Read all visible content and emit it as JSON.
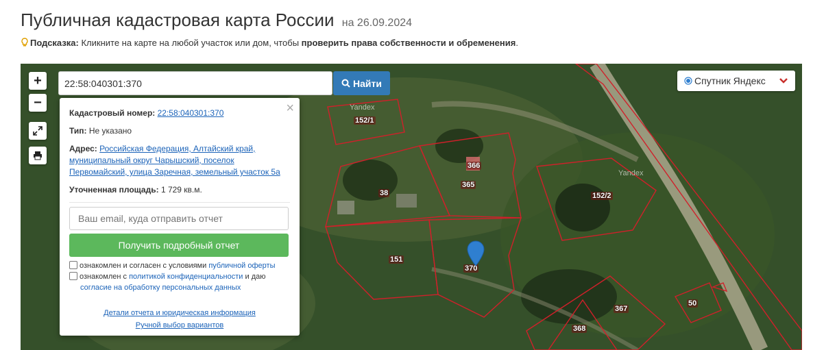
{
  "header": {
    "title": "Публичная кадастровая карта России",
    "date": "на 26.09.2024"
  },
  "hint": {
    "bold_label": "Подсказка:",
    "text": " Кликните на карте на любой участок или дом, чтобы ",
    "bold_action": "проверить права собственности и обременения",
    "end": "."
  },
  "map": {
    "zoom_in": "+",
    "zoom_out": "−",
    "search_value": "22:58:040301:370",
    "find_label": "Найти",
    "layer": "Спутник Яндекс",
    "parcel_labels": [
      "152/1",
      "366",
      "365",
      "38",
      "152/2",
      "151",
      "370",
      "367",
      "50",
      "368"
    ],
    "watermark": "Yandex"
  },
  "popup": {
    "cad_label": "Кадастровый номер:",
    "cad_value": "22:58:040301:370",
    "type_label": "Тип:",
    "type_value": "Не указано",
    "address_label": "Адрес:",
    "address_value": "Российская Федерация, Алтайский край, муниципальный округ Чарышский, поселок Первомайский, улица Заречная, земельный участок 5а",
    "area_label": "Уточненная площадь:",
    "area_value": "1 729 кв.м.",
    "email_placeholder": "Ваш email, куда отправить отчет",
    "report_button": "Получить подробный отчет",
    "check1_text": "ознакомлен и согласен с условиями ",
    "check1_link": "публичной оферты",
    "check2_text": "ознакомлен с ",
    "check2_link": "политикой конфиденциальности",
    "check2_mid": " и даю",
    "check2_link2": "согласие на обработку персональных данных",
    "footer_link1": "Детали отчета и юридическая информация",
    "footer_link2": "Ручной выбор вариантов"
  },
  "colors": {
    "accent_blue": "#337ab7",
    "report_green": "#5cb85c",
    "parcel_red": "#d0202a",
    "marker_blue": "#2f7fd0"
  },
  "icons": [
    "lightbulb-icon",
    "search-icon",
    "fullscreen-icon",
    "print-icon",
    "radio-icon",
    "chevron-down-icon",
    "close-icon",
    "map-marker-icon"
  ]
}
